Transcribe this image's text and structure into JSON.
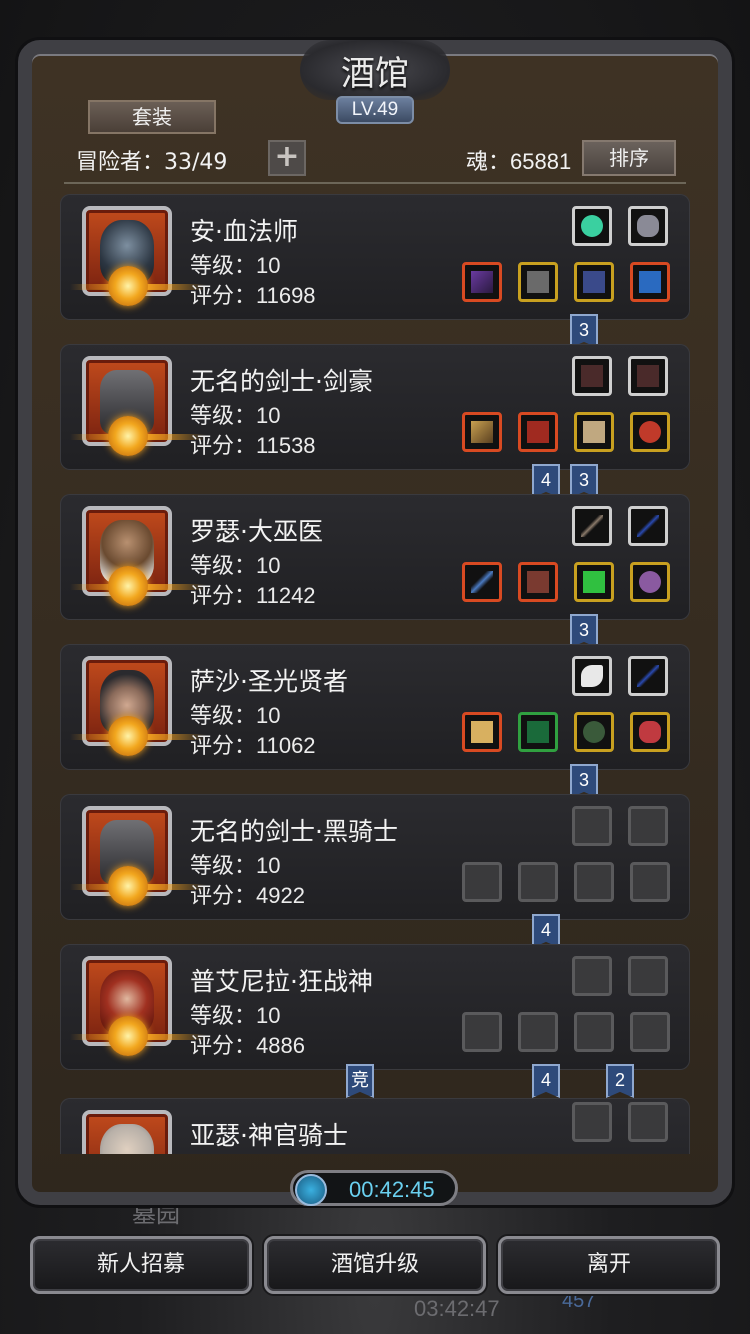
{
  "header": {
    "title": "酒馆",
    "level": "LV.49",
    "set_button": "套装",
    "adventurers": "冒险者：33/49",
    "add_button": "+",
    "soul": "魂：65881",
    "sort_button": "排序"
  },
  "heroes": [
    {
      "name": "安·血法师",
      "level": "等级：10",
      "score": "评分：11698"
    },
    {
      "name": "无名的剑士·剑豪",
      "level": "等级：10",
      "score": "评分：11538"
    },
    {
      "name": "罗瑟·大巫医",
      "level": "等级：10",
      "score": "评分：11242"
    },
    {
      "name": "萨沙·圣光贤者",
      "level": "等级：10",
      "score": "评分：11062"
    },
    {
      "name": "无名的剑士·黑骑士",
      "level": "等级：10",
      "score": "评分：4922"
    },
    {
      "name": "普艾尼拉·狂战神",
      "level": "等级：10",
      "score": "评分：4886"
    },
    {
      "name": "亚瑟·神官骑士",
      "level": "",
      "score": ""
    }
  ],
  "badges": {
    "b1": "3",
    "b2a": "4",
    "b2b": "3",
    "b3": "3",
    "b4": "3",
    "b5": "4",
    "b6a": "竞",
    "b6b": "4",
    "b6c": "2"
  },
  "timer": "00:42:45",
  "bottom": {
    "recruit": "新人招募",
    "upgrade": "酒馆升级",
    "leave": "离开"
  },
  "background_ghost": {
    "label": "墓园",
    "time": "03:42:47",
    "num": "457"
  },
  "colors": {
    "frame": "#3f3f44",
    "card": "#2b2b2f",
    "badge": "#2e4a7a",
    "timer_text": "#6ad0f0"
  }
}
